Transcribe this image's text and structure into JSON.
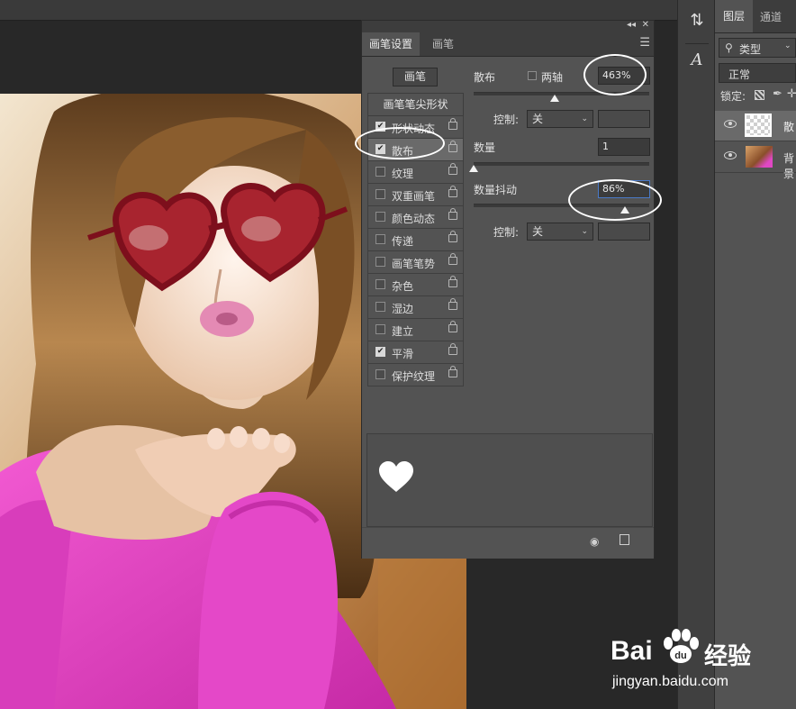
{
  "brush_panel": {
    "tabs": [
      "画笔设置",
      "画笔"
    ],
    "presets_button": "画笔",
    "tip_shape": "画笔笔尖形状",
    "options": [
      {
        "label": "形状动态",
        "checked": true
      },
      {
        "label": "散布",
        "checked": true
      },
      {
        "label": "纹理",
        "checked": false
      },
      {
        "label": "双重画笔",
        "checked": false
      },
      {
        "label": "颜色动态",
        "checked": false
      },
      {
        "label": "传递",
        "checked": false
      },
      {
        "label": "画笔笔势",
        "checked": false
      },
      {
        "label": "杂色",
        "checked": false
      },
      {
        "label": "湿边",
        "checked": false
      },
      {
        "label": "建立",
        "checked": false
      },
      {
        "label": "平滑",
        "checked": true
      },
      {
        "label": "保护纹理",
        "checked": false
      }
    ],
    "scatter": {
      "label": "散布",
      "both_axes_label": "两轴",
      "both_axes_checked": false,
      "value": "463%",
      "slider_fraction": 0.46
    },
    "control_1": {
      "label": "控制:",
      "value": "关"
    },
    "count": {
      "label": "数量",
      "value": "1",
      "slider_fraction": 0.0
    },
    "count_jitter": {
      "label": "数量抖动",
      "value": "86%",
      "slider_fraction": 0.86
    },
    "control_2": {
      "label": "控制:",
      "value": "关"
    }
  },
  "layers_panel": {
    "tabs": [
      "图层",
      "通道"
    ],
    "filter_kind": "类型",
    "blend_mode": "正常",
    "lock_label": "锁定:",
    "layers": [
      {
        "name": "散",
        "visible": true
      },
      {
        "name": "背景",
        "visible": true
      }
    ]
  },
  "watermark": {
    "brand": "Bai",
    "brand_cn": "经验",
    "url": "jingyan.baidu.com"
  },
  "colors": {
    "panel_bg": "#535353",
    "dark_bg": "#282828",
    "focus_blue": "#4a7ac8",
    "sweater_pink": "#e03cc0"
  }
}
